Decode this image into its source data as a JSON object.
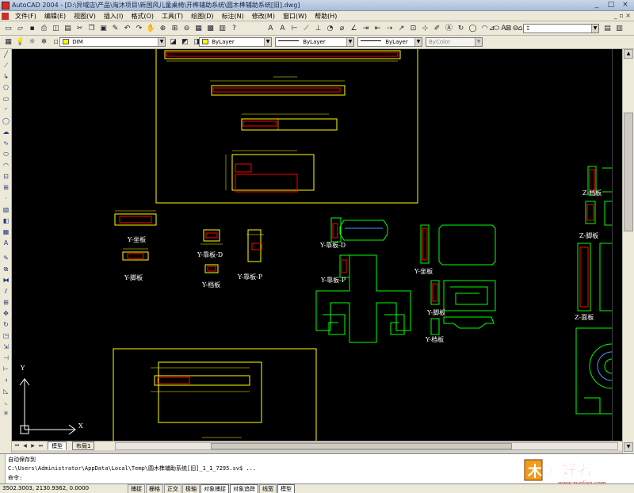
{
  "window": {
    "title": "AutoCAD 2004 - [D:\\异域店\\产品\\淘沐项目\\新国风儿童桌椅\\开榫辅助系统\\圆木榫辅助系统[旧].dwg]",
    "controls": [
      "_",
      "□",
      "×"
    ]
  },
  "menu": {
    "items": [
      "文件(F)",
      "编辑(E)",
      "视图(V)",
      "插入(I)",
      "格式(O)",
      "工具(T)",
      "绘图(D)",
      "标注(N)",
      "修改(M)",
      "窗口(W)",
      "帮助(H)"
    ],
    "mdi_controls": "_ ▫ ×"
  },
  "toolbar": {
    "layer_combo": "DIM",
    "color_combo": "ByLayer",
    "color_hex": "#ffff00",
    "linetype_combo": "ByLayer",
    "lineweight_combo": "ByLayer",
    "plotstyle_combo": "ByColor",
    "dimstyle_combo": "Ξ"
  },
  "drawing": {
    "labels": {
      "y_zuoban": "Y-坐板",
      "y_jiaoban": "Y-脚板",
      "y_kaoban_d": "Y-靠板-D",
      "y_dangban": "Y-档板",
      "y_kaoban_p": "Y-靠板-P",
      "y_kaoban_d2": "Y-靠板-D",
      "y_kaoban_p2": "Y-靠板-P",
      "y_zuoban2": "Y-坐板",
      "y_jiaoban2": "Y-脚板",
      "y_dangban2": "Y-档板",
      "z_dangban": "Z-档板",
      "z_jiaoban": "Z-脚板",
      "z_mianban": "Z-面板",
      "ucs_y": "Y",
      "ucs_x": "X"
    },
    "colors": {
      "background": "#000000",
      "frame": "#ffff00",
      "part": "#ff0000",
      "outline": "#00ff00",
      "dim": "#ffff00",
      "accent": "#3aa0ff"
    }
  },
  "tabs": {
    "model": "模型",
    "layout": "布局1"
  },
  "command": {
    "line1": "自动保存到",
    "line2": "C:\\Users\\Administrator\\AppData\\Local\\Temp\\圆木榫辅助系统[旧]_1_1_7295.sv$ ...",
    "line3": "命令:"
  },
  "status": {
    "coords": "3502.3003,  2130.9362,  0.0000",
    "buttons": [
      "捕捉",
      "栅格",
      "正交",
      "极轴",
      "对象捕捉",
      "对象追踪",
      "线宽",
      "模型"
    ],
    "active": [
      "对象捕捉",
      "对象追踪",
      "模型"
    ]
  },
  "watermark": {
    "brand": "爱好者",
    "url": "www.zuoliao.com"
  }
}
